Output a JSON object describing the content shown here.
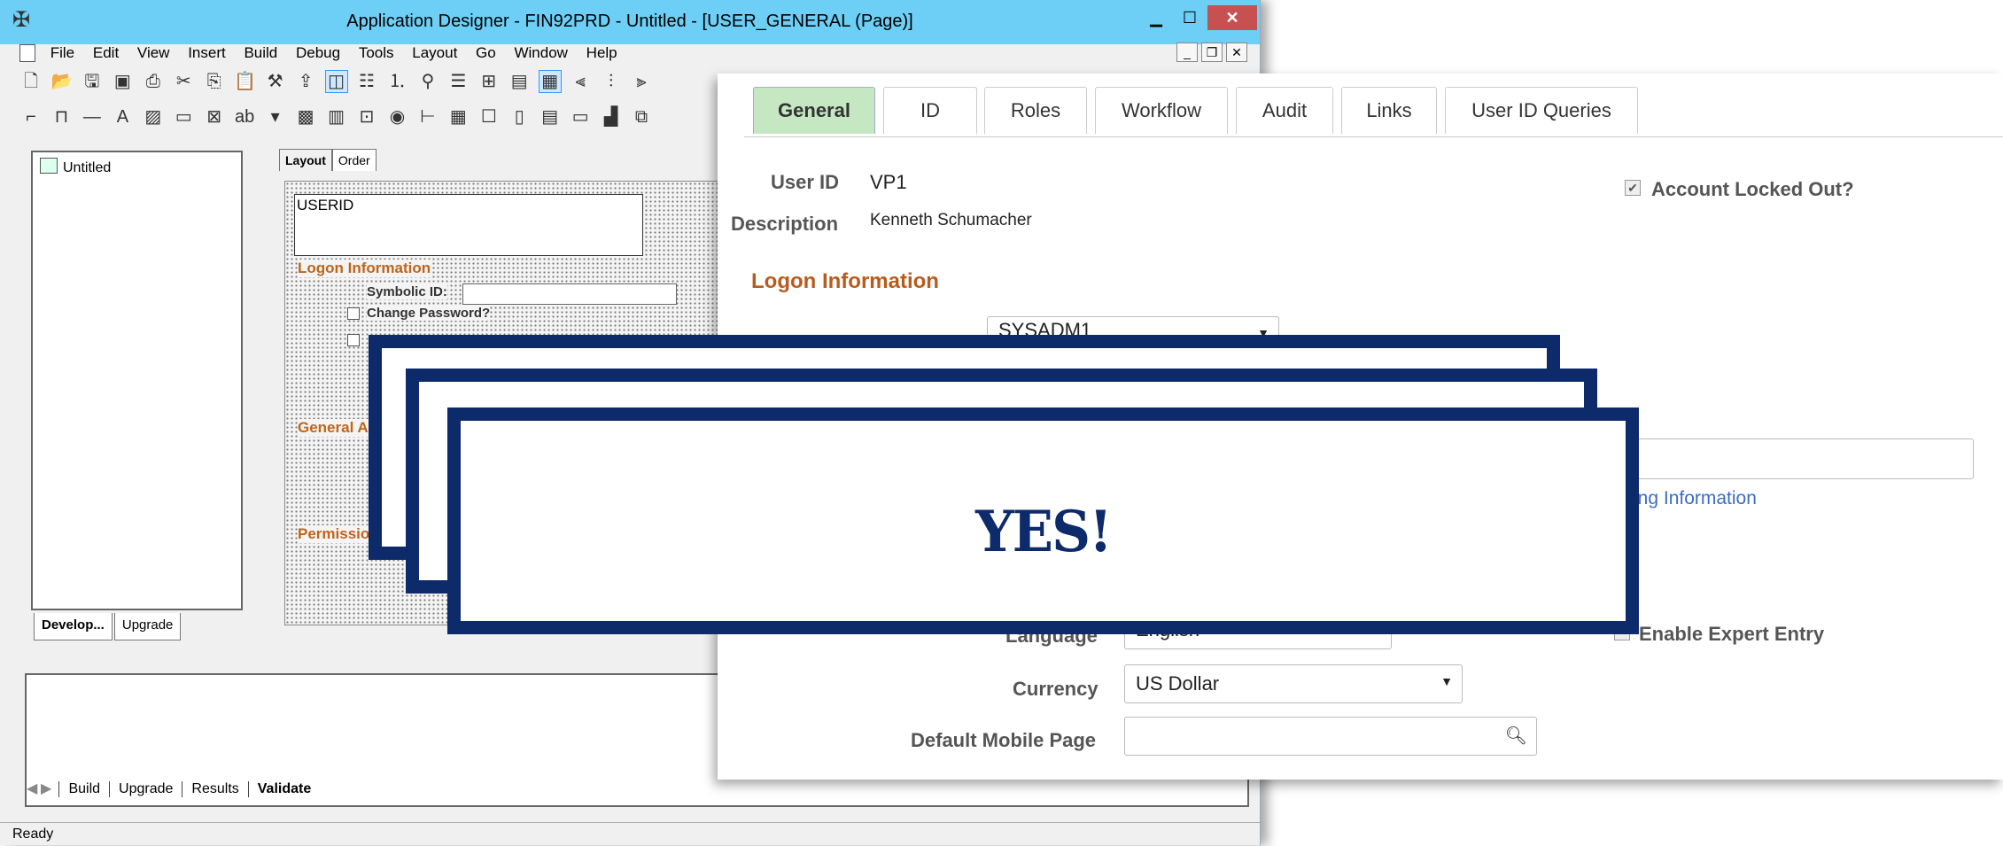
{
  "app": {
    "title": "Application Designer - FIN92PRD - Untitled - [USER_GENERAL (Page)]",
    "menu": [
      "File",
      "Edit",
      "View",
      "Insert",
      "Build",
      "Debug",
      "Tools",
      "Layout",
      "Go",
      "Window",
      "Help"
    ],
    "workspace": {
      "tree_root": "Untitled",
      "tabs": [
        "Develop...",
        "Upgrade"
      ]
    },
    "page_tabs": [
      "Layout",
      "Order"
    ],
    "canvas": {
      "userid_field": "USERID",
      "logon_section": "Logon Information",
      "symbolic_id_label": "Symbolic ID:",
      "change_password_label": "Change Password?",
      "general_section": "General A",
      "permissions_section": "Permissio"
    },
    "output_tabs": [
      "Build",
      "Upgrade",
      "Results",
      "Validate"
    ],
    "status": "Ready"
  },
  "ps": {
    "tabs": [
      "General",
      "ID",
      "Roles",
      "Workflow",
      "Audit",
      "Links",
      "User ID Queries"
    ],
    "active_tab": "General",
    "user_id_label": "User ID",
    "user_id_value": "VP1",
    "description_label": "Description",
    "description_value": "Kenneth Schumacher",
    "account_locked_label": "Account Locked Out?",
    "account_locked_checked": true,
    "logon_heading": "Logon Information",
    "symbolic_value": "SYSADM1",
    "link_text": "ing Information",
    "language_label": "Language",
    "language_value": "English",
    "enable_expert_label": "Enable Expert Entry",
    "currency_label": "Currency",
    "currency_value": "US Dollar",
    "mobile_label": "Default Mobile Page",
    "mobile_value": ""
  },
  "overlay": {
    "text": "YES!",
    "color": "#0d2a6b"
  }
}
